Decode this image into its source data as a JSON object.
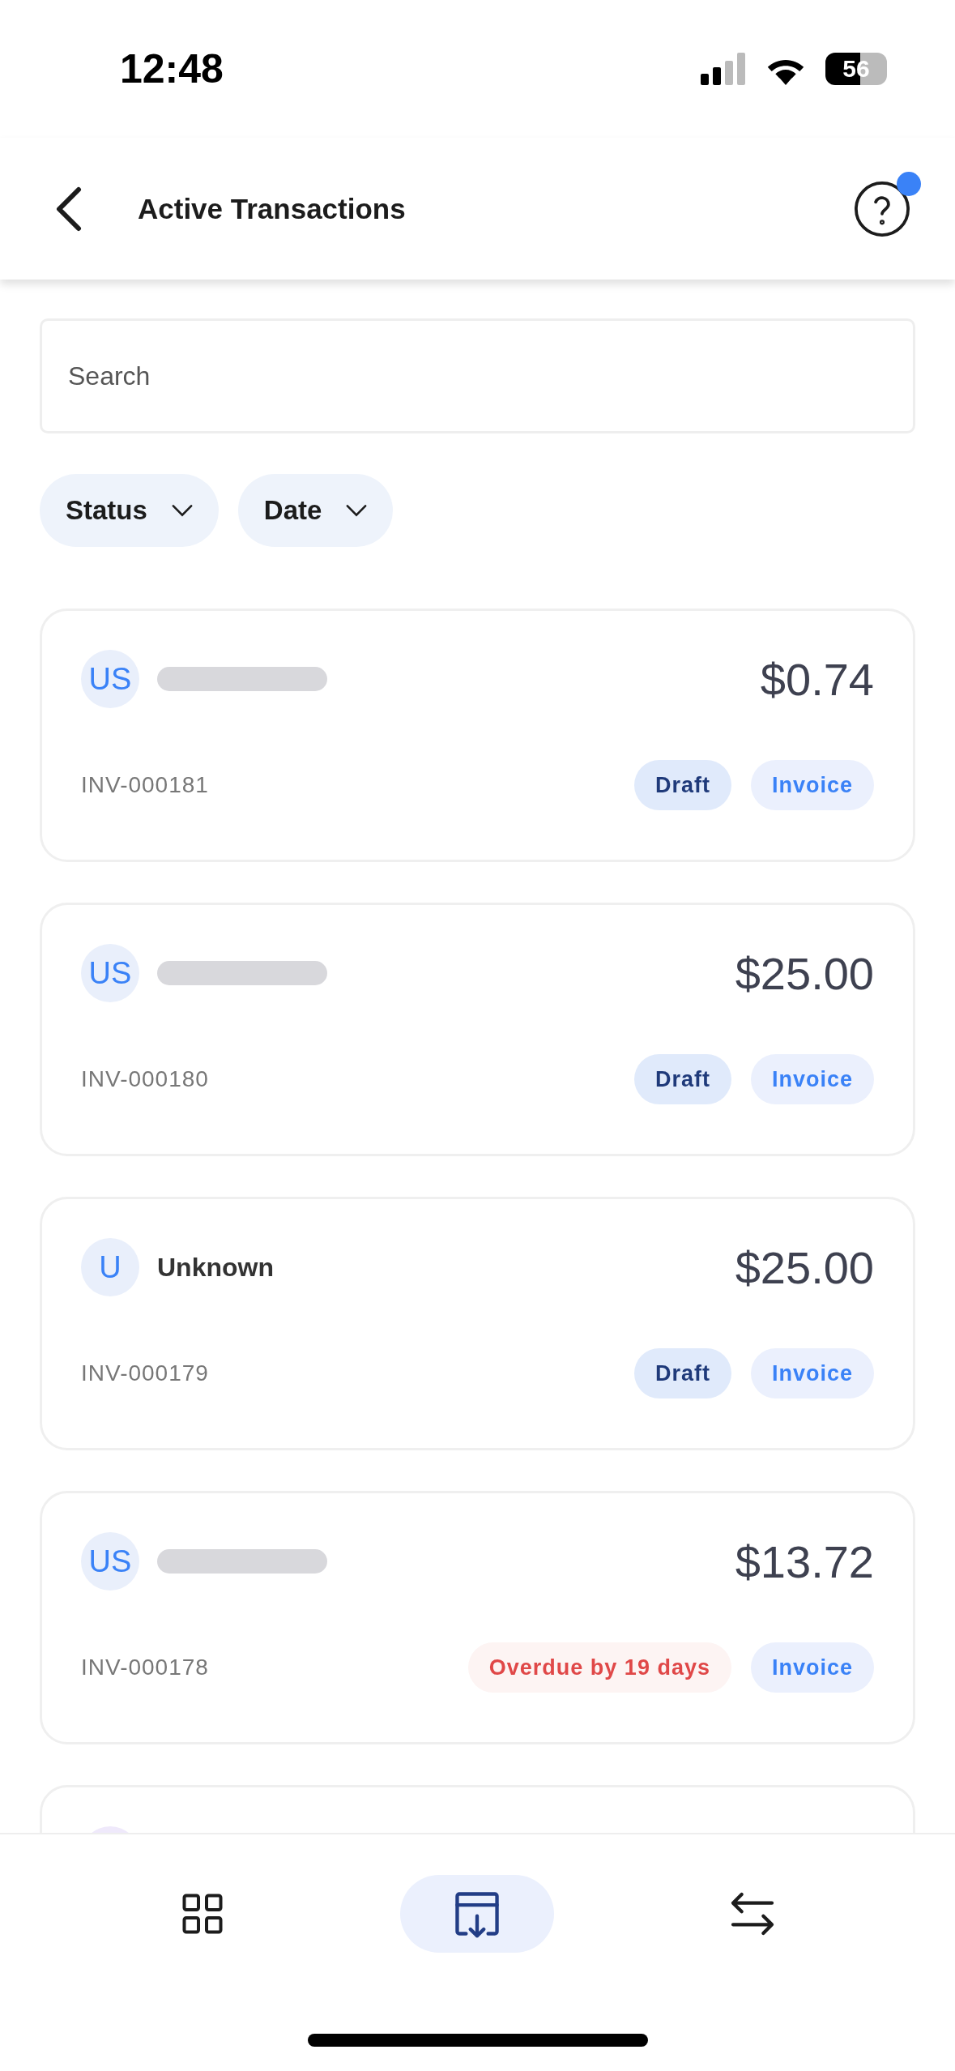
{
  "status_bar": {
    "time": "12:48",
    "battery": "56"
  },
  "header": {
    "title": "Active Transactions",
    "help_notification": true
  },
  "search": {
    "placeholder": "Search"
  },
  "filters": [
    {
      "label": "Status"
    },
    {
      "label": "Date"
    }
  ],
  "transactions": [
    {
      "initials": "US",
      "name_redacted": true,
      "amount": "$0.74",
      "number": "INV-000181",
      "status": {
        "kind": "draft",
        "label": "Draft"
      },
      "type": "Invoice"
    },
    {
      "initials": "US",
      "name_redacted": true,
      "amount": "$25.00",
      "number": "INV-000180",
      "status": {
        "kind": "draft",
        "label": "Draft"
      },
      "type": "Invoice"
    },
    {
      "initials": "U",
      "name": "Unknown",
      "name_redacted": false,
      "amount": "$25.00",
      "number": "INV-000179",
      "status": {
        "kind": "draft",
        "label": "Draft"
      },
      "type": "Invoice"
    },
    {
      "initials": "US",
      "name_redacted": true,
      "amount": "$13.72",
      "number": "INV-000178",
      "status": {
        "kind": "overdue",
        "label": "Overdue by 19 days"
      },
      "type": "Invoice"
    }
  ],
  "more_below": true,
  "bottom_nav": [
    {
      "kind": "grid",
      "selected": false
    },
    {
      "kind": "inbox",
      "selected": true
    },
    {
      "kind": "transfer",
      "selected": false
    }
  ]
}
